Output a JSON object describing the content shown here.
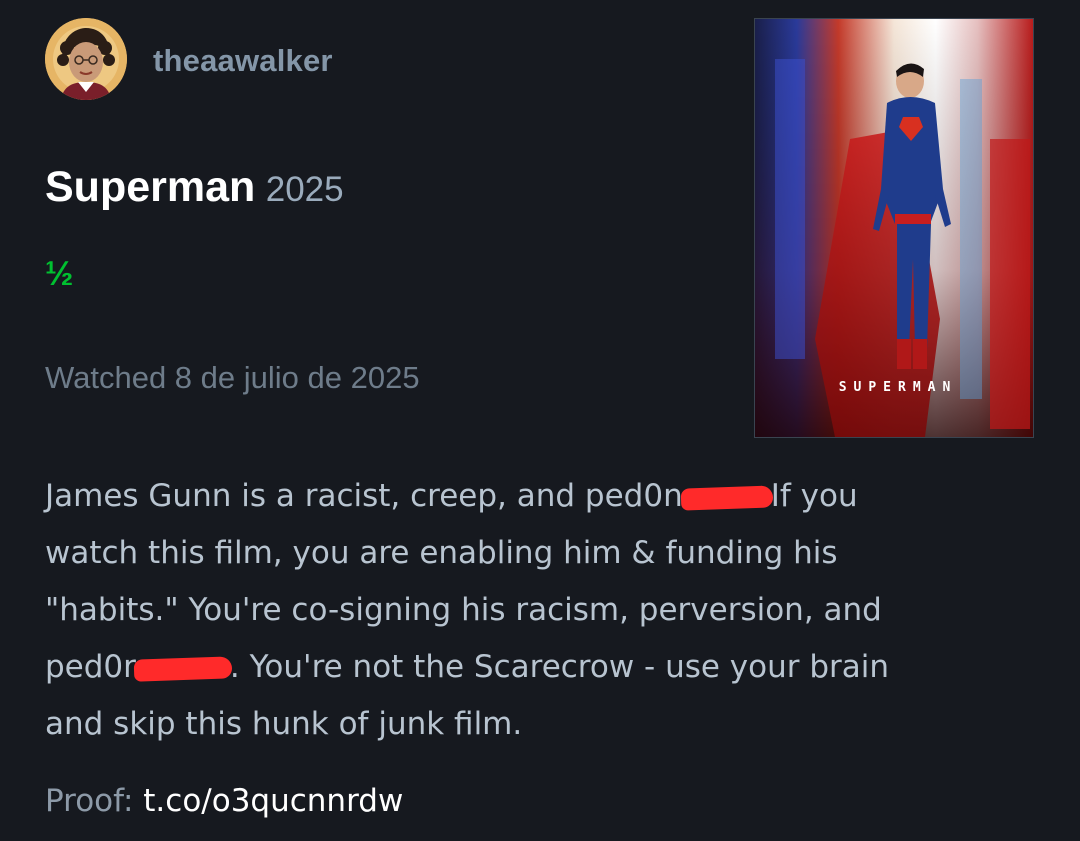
{
  "user": {
    "username": "theaawalker",
    "avatar_icon": "cartoon-avatar-icon"
  },
  "film": {
    "title": "Superman",
    "year": "2025",
    "rating": "½",
    "watched": "Watched 8 de julio de 2025",
    "poster_title": "SUPERMAN"
  },
  "review": {
    "line1_a": "James Gunn is a racist, creep, and ped0n",
    "line1_b": "If you",
    "line2": "watch this film, you are enabling him & funding his",
    "line3": "\"habits.\" You're co-signing his racism, perversion, and",
    "line4_a": "ped0r",
    "line4_b": ". You're not the Scarecrow - use your brain",
    "line5": "and skip this hunk of junk film."
  },
  "proof": {
    "label": "Proof:",
    "link": "t.co/o3qucnnrdw"
  },
  "colors": {
    "background": "#16191f",
    "rating_green": "#00c030",
    "redaction_red": "#ff2a2a"
  }
}
